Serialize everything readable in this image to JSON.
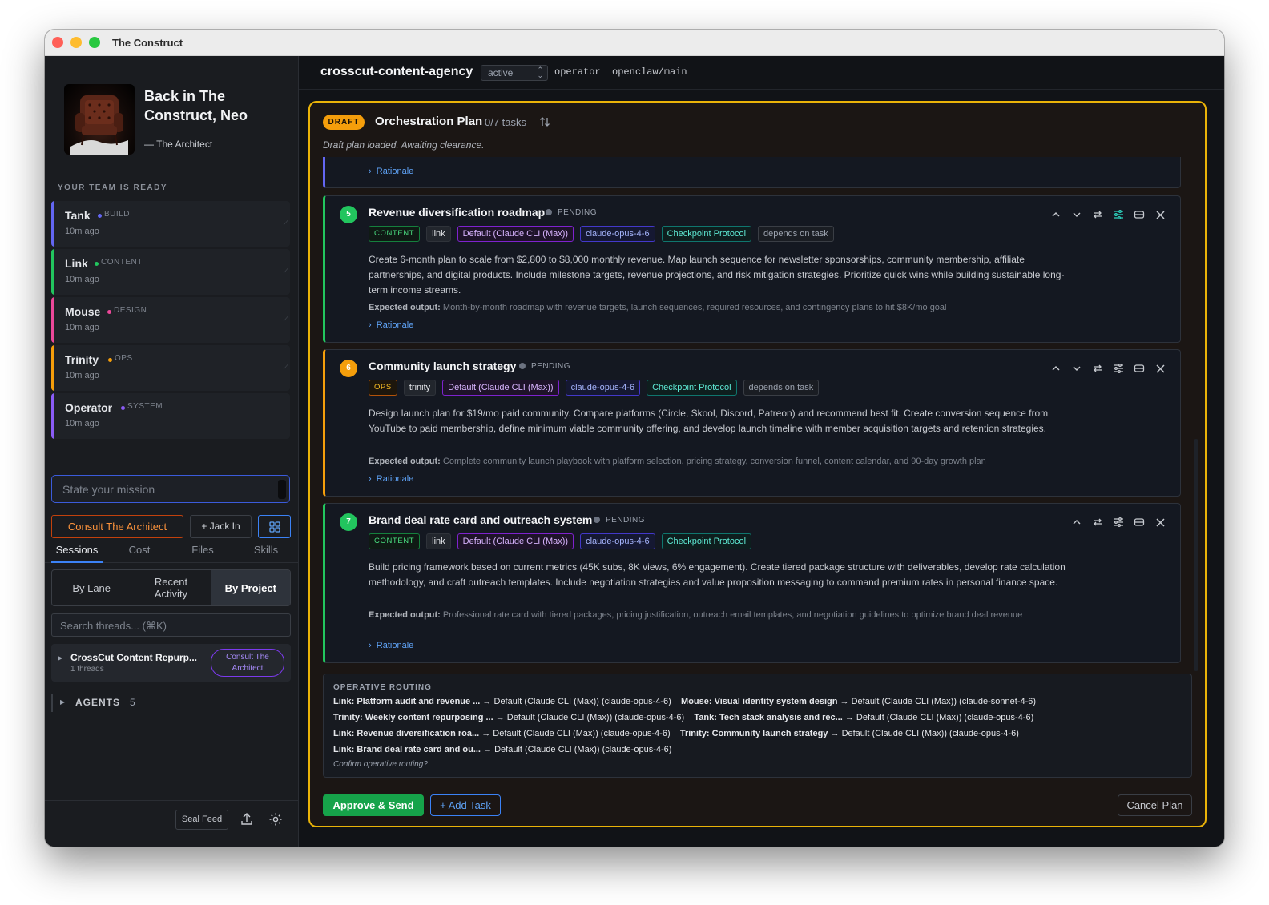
{
  "window": {
    "title": "The Construct"
  },
  "hero": {
    "title": "Back in The Construct, Neo",
    "subtitle": "— The Architect"
  },
  "team": {
    "heading": "YOUR TEAM IS READY",
    "agents": [
      {
        "name": "Tank",
        "role": "BUILD",
        "ago": "10m ago",
        "color": "#6366f1"
      },
      {
        "name": "Link",
        "role": "CONTENT",
        "ago": "10m ago",
        "color": "#22c55e"
      },
      {
        "name": "Mouse",
        "role": "DESIGN",
        "ago": "10m ago",
        "color": "#ec4899"
      },
      {
        "name": "Trinity",
        "role": "OPS",
        "ago": "10m ago",
        "color": "#f59e0b"
      },
      {
        "name": "Operator",
        "role": "SYSTEM",
        "ago": "10m ago",
        "color": "#8b5cf6"
      }
    ]
  },
  "mission": {
    "placeholder": "State your mission"
  },
  "actions": {
    "consult": "Consult The Architect",
    "jack_in": "+ Jack In"
  },
  "tabs": [
    "Sessions",
    "Cost",
    "Files",
    "Skills"
  ],
  "views": [
    "By Lane",
    "Recent Activity",
    "By Project"
  ],
  "search": {
    "placeholder": "Search threads... (⌘K)"
  },
  "project": {
    "name": "CrossCut Content Repurp...",
    "threads": "1 threads",
    "consult": "Consult The Architect"
  },
  "agents_section": {
    "label": "AGENTS",
    "count": "5"
  },
  "footer": {
    "seal_feed": "Seal Feed"
  },
  "topbar": {
    "project": "crosscut-content-agency",
    "status": "active",
    "operator_label": "operator",
    "operator_branch": "openclaw/main"
  },
  "plan": {
    "badge": "DRAFT",
    "title": "Orchestration Plan",
    "count": "0/7 tasks",
    "message": "Draft plan loaded. Awaiting clearance.",
    "rationale_label": "Rationale",
    "status_label": "PENDING",
    "expected_label": "Expected output:",
    "tasks": [
      {
        "num": "5",
        "title": "Revenue diversification roadmap",
        "lane": "CONTENT",
        "agent": "link",
        "provider": "Default (Claude CLI (Max))",
        "model": "claude-opus-4-6",
        "protocol": "Checkpoint Protocol",
        "depends": "depends on task",
        "description": "Create 6-month plan to scale from $2,800 to $8,000 monthly revenue. Map launch sequence for newsletter sponsorships, community membership, affiliate partnerships, and digital products. Include milestone targets, revenue projections, and risk mitigation strategies. Prioritize quick wins while building sustainable long-term income streams.",
        "expected": "Month-by-month roadmap with revenue targets, launch sequences, required resources, and contingency plans to hit $8K/mo goal",
        "color": "#22c55e"
      },
      {
        "num": "6",
        "title": "Community launch strategy",
        "lane": "OPS",
        "agent": "trinity",
        "provider": "Default (Claude CLI (Max))",
        "model": "claude-opus-4-6",
        "protocol": "Checkpoint Protocol",
        "depends": "depends on task",
        "description": "Design launch plan for $19/mo paid community. Compare platforms (Circle, Skool, Discord, Patreon) and recommend best fit. Create conversion sequence from YouTube to paid membership, define minimum viable community offering, and develop launch timeline with member acquisition targets and retention strategies.",
        "expected": "Complete community launch playbook with platform selection, pricing strategy, conversion funnel, content calendar, and 90-day growth plan",
        "color": "#f59e0b"
      },
      {
        "num": "7",
        "title": "Brand deal rate card and outreach system",
        "lane": "CONTENT",
        "agent": "link",
        "provider": "Default (Claude CLI (Max))",
        "model": "claude-opus-4-6",
        "protocol": "Checkpoint Protocol",
        "description": "Build pricing framework based on current metrics (45K subs, 8K views, 6% engagement). Create tiered package structure with deliverables, develop rate calculation methodology, and craft outreach templates. Include negotiation strategies and value proposition messaging to command premium rates in personal finance space.",
        "expected": "Professional rate card with tiered packages, pricing justification, outreach email templates, and negotiation guidelines to optimize brand deal revenue",
        "color": "#22c55e"
      }
    ],
    "routing": {
      "heading": "OPERATIVE ROUTING",
      "rows": [
        [
          {
            "task": "Link: Platform audit and revenue ...",
            "target": "Default (Claude CLI (Max)) (claude-opus-4-6)"
          },
          {
            "task": "Mouse: Visual identity system design",
            "target": "Default (Claude CLI (Max)) (claude-sonnet-4-6)"
          }
        ],
        [
          {
            "task": "Trinity: Weekly content repurposing ...",
            "target": "Default (Claude CLI (Max)) (claude-opus-4-6)"
          },
          {
            "task": "Tank: Tech stack analysis and rec...",
            "target": "Default (Claude CLI (Max)) (claude-opus-4-6)"
          }
        ],
        [
          {
            "task": "Link: Revenue diversification roa...",
            "target": "Default (Claude CLI (Max)) (claude-opus-4-6)"
          },
          {
            "task": "Trinity: Community launch strategy",
            "target": "Default (Claude CLI (Max)) (claude-opus-4-6)"
          }
        ],
        [
          {
            "task": "Link: Brand deal rate card and ou...",
            "target": "Default (Claude CLI (Max)) (claude-opus-4-6)"
          }
        ]
      ],
      "confirm": "Confirm operative routing?"
    },
    "buttons": {
      "approve": "Approve & Send",
      "add_task": "+ Add Task",
      "cancel": "Cancel Plan"
    }
  }
}
